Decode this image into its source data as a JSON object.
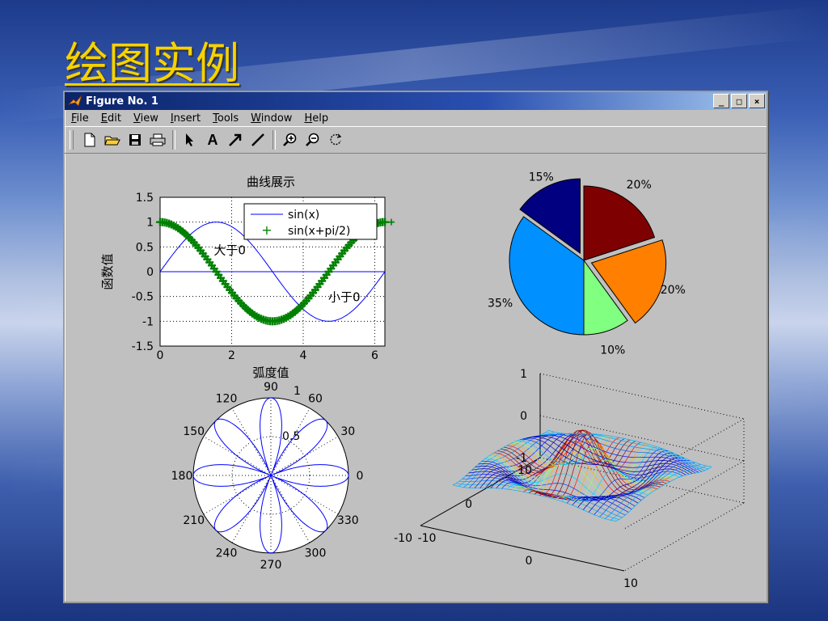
{
  "slide": {
    "title": "绘图实例"
  },
  "window": {
    "title": "Figure No. 1",
    "controls": {
      "minimize": "_",
      "maximize": "□",
      "close": "×"
    }
  },
  "menu": [
    "File",
    "Edit",
    "View",
    "Insert",
    "Tools",
    "Window",
    "Help"
  ],
  "toolbar": {
    "icons": [
      "new-file-icon",
      "open-folder-icon",
      "save-icon",
      "print-icon",
      "arrow-select-icon",
      "text-icon",
      "arrow-icon",
      "line-icon",
      "zoom-in-icon",
      "zoom-out-icon",
      "rotate-icon"
    ],
    "text_tool_label": "A"
  },
  "chart_data": [
    {
      "type": "line",
      "title": "曲线展示",
      "xlabel": "弧度值",
      "ylabel": "函数值",
      "xlim": [
        0,
        6.2832
      ],
      "ylim": [
        -1.5,
        1.5
      ],
      "xticks": [
        "0",
        "2",
        "4",
        "6"
      ],
      "yticks": [
        "1.5",
        "1",
        "0.5",
        "0",
        "-0.5",
        "-1",
        "-1.5"
      ],
      "grid": true,
      "legend": {
        "position": "top-right",
        "entries": [
          "sin(x)",
          "sin(x+pi/2)"
        ]
      },
      "series": [
        {
          "name": "sin(x)",
          "function": "sin(x)",
          "color": "#0000ff",
          "style": "line"
        },
        {
          "name": "sin(x+pi/2)",
          "function": "sin(x+pi/2)",
          "color": "#008000",
          "style": "plus-markers"
        },
        {
          "function": "0",
          "color": "#0000ff",
          "style": "line"
        }
      ],
      "annotations": [
        {
          "text": "大于0",
          "x": 1.5,
          "y": 0.45
        },
        {
          "text": "小于0",
          "x": 4.7,
          "y": -0.5
        }
      ]
    },
    {
      "type": "pie",
      "slices": [
        {
          "label": "20%",
          "value": 20,
          "color": "#7f0000",
          "exploded": false
        },
        {
          "label": "20%",
          "value": 20,
          "color": "#ff7f00",
          "exploded": true
        },
        {
          "label": "10%",
          "value": 10,
          "color": "#80ff80",
          "exploded": false
        },
        {
          "label": "35%",
          "value": 35,
          "color": "#0090ff",
          "exploded": false
        },
        {
          "label": "15%",
          "value": 15,
          "color": "#000080",
          "exploded": true
        }
      ]
    },
    {
      "type": "polar",
      "function": "cos(4*theta)",
      "color": "#0000ff",
      "r_labels": [
        "0.5",
        "1"
      ],
      "angle_labels": [
        "90",
        "60",
        "30",
        "0",
        "330",
        "300",
        "270",
        "240",
        "210",
        "180",
        "150",
        "120"
      ]
    },
    {
      "type": "surface-mesh",
      "function": "sinc peak (mexican hat)",
      "zticks": [
        "1",
        "0",
        "-1"
      ],
      "xticks": [
        "-10",
        "0",
        "10"
      ],
      "yticks": [
        "10",
        "0",
        "-10"
      ],
      "colormap": "jet"
    }
  ]
}
